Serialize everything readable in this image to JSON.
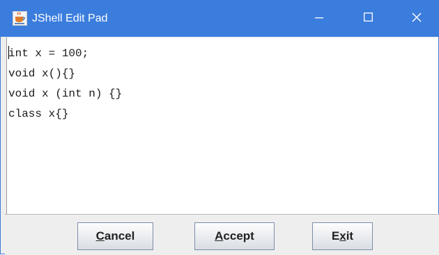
{
  "window": {
    "title": "JShell Edit Pad",
    "title_color": "#3b7ddd",
    "app_icon": "java-cup-icon",
    "controls": [
      "minimize-icon",
      "maximize-icon",
      "close-icon"
    ]
  },
  "editor": {
    "lines": [
      "int x = 100;",
      "void x(){}",
      "void x (int n) {}",
      "class x{}"
    ]
  },
  "buttons": {
    "cancel": {
      "mnemonic": "C",
      "rest": "ancel"
    },
    "accept": {
      "mnemonic": "A",
      "rest": "ccept"
    },
    "exit": {
      "before": "E",
      "mnemonic": "x",
      "rest": "it"
    }
  }
}
